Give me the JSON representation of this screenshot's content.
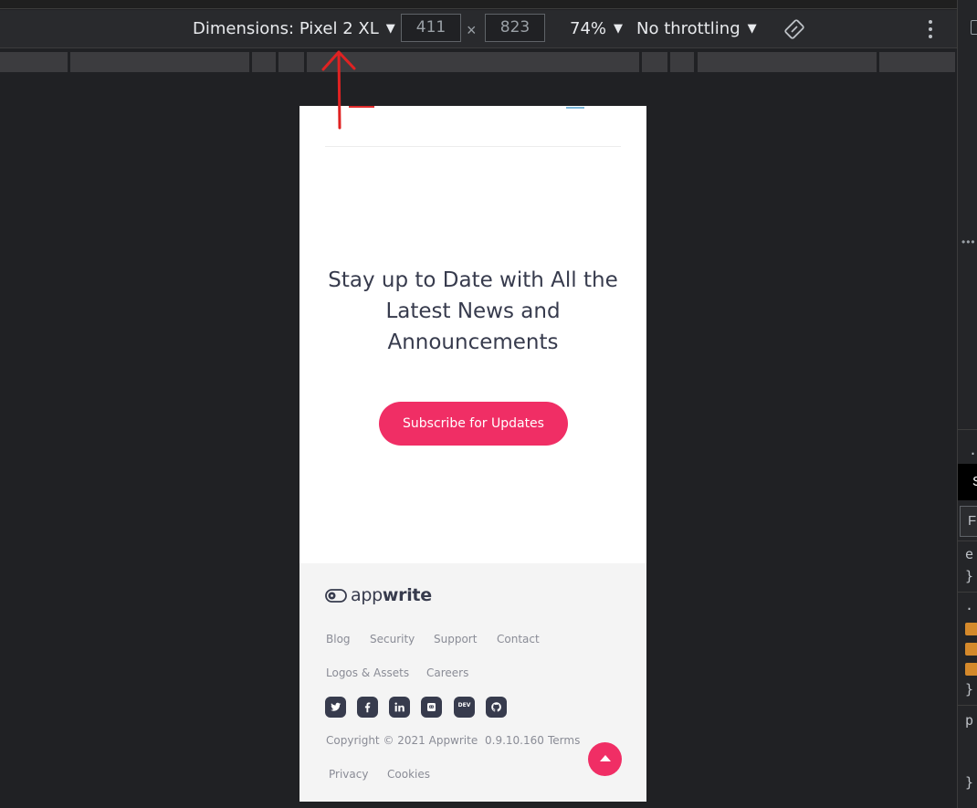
{
  "toolbar": {
    "device_label": "Dimensions: Pixel 2 XL",
    "width_value": "411",
    "height_value": "823",
    "times_symbol": "×",
    "zoom_label": "74%",
    "throttling_label": "No throttling",
    "caret": "▼"
  },
  "page": {
    "headline_line1": "Stay up to Date with All the",
    "headline_line2": "Latest News and",
    "headline_line3": "Announcements",
    "subscribe_label": "Subscribe for Updates"
  },
  "footer": {
    "logo_text_light": "app",
    "logo_text_bold": "write",
    "links_row1": [
      "Blog",
      "Security",
      "Support",
      "Contact"
    ],
    "links_row2": [
      "Logos & Assets",
      "Careers"
    ],
    "social_icons": [
      "twitter-icon",
      "facebook-icon",
      "linkedin-icon",
      "discord-icon",
      "dev-icon",
      "github-icon"
    ],
    "dev_icon_text": "DEV",
    "copyright": "Copyright © 2021 Appwrite",
    "version": "0.9.10.160",
    "terms": "Terms",
    "privacy": "Privacy",
    "cookies": "Cookies"
  },
  "devtools_sidebar": {
    "text_e": "e",
    "brace1": "}",
    "dot": ".",
    "brace2": "}",
    "p": "p",
    "brace3": "}",
    "black_tab": "S",
    "filter_box": "F"
  },
  "colors": {
    "accent": "#f02e65",
    "devtools_bg": "#202124",
    "footer_bg": "#f4f4f4",
    "annotation": "#e02222"
  }
}
